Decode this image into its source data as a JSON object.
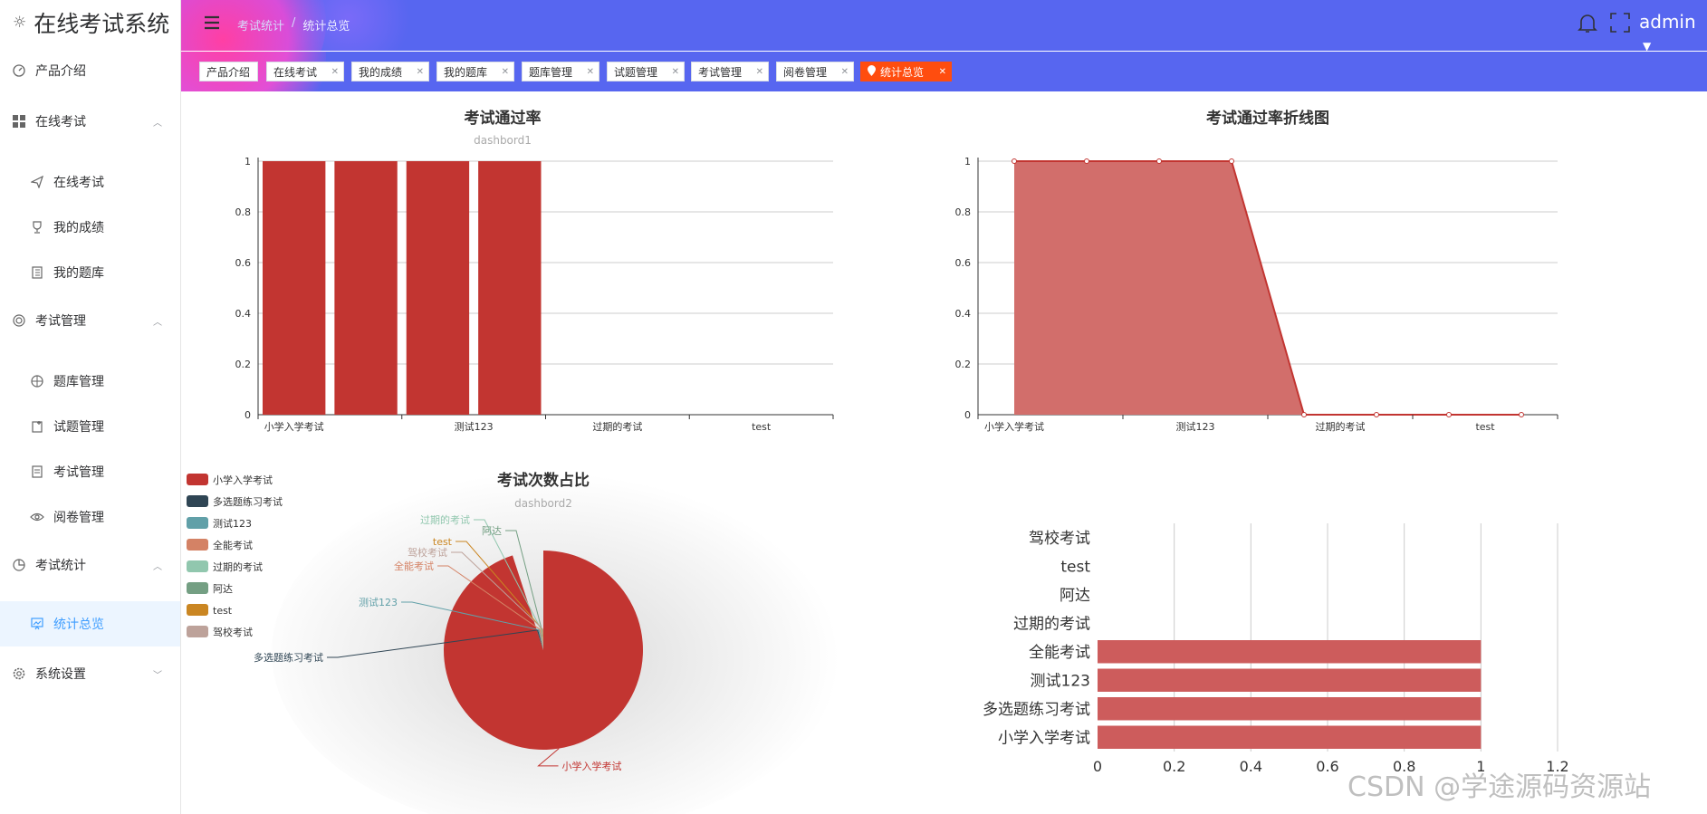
{
  "app": {
    "title": "在线考试系统"
  },
  "sidebar": {
    "items": [
      {
        "label": "产品介绍"
      },
      {
        "label": "在线考试"
      },
      {
        "label": "在线考试"
      },
      {
        "label": "我的成绩"
      },
      {
        "label": "我的题库"
      },
      {
        "label": "考试管理"
      },
      {
        "label": "题库管理"
      },
      {
        "label": "试题管理"
      },
      {
        "label": "考试管理"
      },
      {
        "label": "阅卷管理"
      },
      {
        "label": "考试统计"
      },
      {
        "label": "统计总览"
      },
      {
        "label": "系统设置"
      }
    ]
  },
  "header": {
    "breadcrumb": [
      "考试统计",
      "统计总览"
    ],
    "user": "admin"
  },
  "tags": [
    {
      "label": "产品介绍"
    },
    {
      "label": "在线考试"
    },
    {
      "label": "我的成绩"
    },
    {
      "label": "我的题库"
    },
    {
      "label": "题库管理"
    },
    {
      "label": "试题管理"
    },
    {
      "label": "考试管理"
    },
    {
      "label": "阅卷管理"
    },
    {
      "label": "统计总览"
    }
  ],
  "colors": {
    "header_bg": "#5766f0",
    "active_tag": "#ff4d0f",
    "bar": "#c23531",
    "area_fill": "#d26e6b",
    "hbar": "#cd5c5c",
    "sidebar_active_bg": "#ecf5ff",
    "sidebar_active_text": "#409eff"
  },
  "watermark": "CSDN @学途源码资源站",
  "chart_data": [
    {
      "type": "bar",
      "title": "考试通过率",
      "subtitle": "dashbord1",
      "categories": [
        "小学入学考试",
        "多选题练习考试",
        "测试123",
        "全能考试",
        "过期的考试",
        "阿达",
        "test",
        "驾校考试"
      ],
      "x_tick_labels": [
        "小学入学考试",
        "测试123",
        "过期的考试",
        "test"
      ],
      "values": [
        1,
        1,
        1,
        1,
        0,
        0,
        0,
        0
      ],
      "y_ticks": [
        "0",
        "0.2",
        "0.4",
        "0.6",
        "0.8",
        "1"
      ],
      "ylim": [
        0,
        1
      ],
      "grid": true
    },
    {
      "type": "area",
      "title": "考试通过率折线图",
      "categories": [
        "小学入学考试",
        "多选题练习考试",
        "测试123",
        "全能考试",
        "过期的考试",
        "阿达",
        "test",
        "驾校考试"
      ],
      "x_tick_labels": [
        "小学入学考试",
        "测试123",
        "过期的考试",
        "test"
      ],
      "values": [
        1,
        1,
        1,
        1,
        0,
        0,
        0,
        0
      ],
      "y_ticks": [
        "0",
        "0.2",
        "0.4",
        "0.6",
        "0.8",
        "1"
      ],
      "ylim": [
        0,
        1
      ],
      "grid": true
    },
    {
      "type": "pie",
      "title": "考试次数占比",
      "subtitle": "dashbord2",
      "legend_position": "left",
      "slices": [
        {
          "label": "小学入学考试",
          "value": 95,
          "color": "#c23531"
        },
        {
          "label": "多选题练习考试",
          "value": 1,
          "color": "#2f4554"
        },
        {
          "label": "测试123",
          "value": 1,
          "color": "#61a0a8"
        },
        {
          "label": "全能考试",
          "value": 1,
          "color": "#d48265"
        },
        {
          "label": "过期的考试",
          "value": 0.5,
          "color": "#91c7ae"
        },
        {
          "label": "阿达",
          "value": 0.5,
          "color": "#749f83"
        },
        {
          "label": "test",
          "value": 0.5,
          "color": "#ca8622"
        },
        {
          "label": "驾校考试",
          "value": 0.5,
          "color": "#bda29a"
        }
      ]
    },
    {
      "type": "bar",
      "orientation": "horizontal",
      "categories": [
        "小学入学考试",
        "多选题练习考试",
        "测试123",
        "全能考试",
        "过期的考试",
        "阿达",
        "test",
        "驾校考试"
      ],
      "values": [
        1,
        1,
        1,
        1,
        0,
        0,
        0,
        0
      ],
      "x_ticks": [
        "0",
        "0.2",
        "0.4",
        "0.6",
        "0.8",
        "1",
        "1.2"
      ],
      "xlim": [
        0,
        1.2
      ],
      "grid": true
    }
  ]
}
